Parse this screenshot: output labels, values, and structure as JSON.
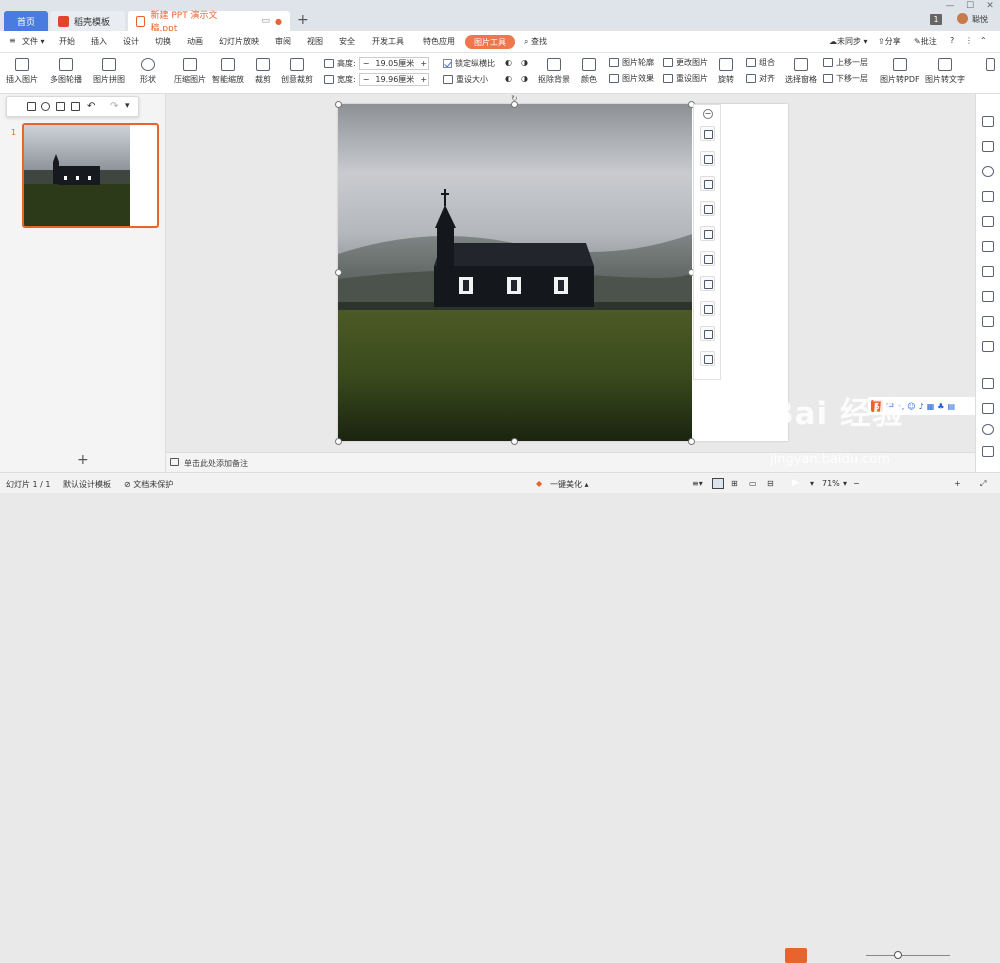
{
  "titlebar": {
    "tab_home": "首页",
    "tab_template": "稻壳模板",
    "tab_document": "新建 PPT 演示文稿.ppt",
    "page_badge": "1",
    "user_name": "聪悦"
  },
  "menubar": {
    "file": "文件",
    "items": [
      "开始",
      "插入",
      "设计",
      "切换",
      "动画",
      "幻灯片放映",
      "审阅",
      "视图",
      "安全",
      "开发工具",
      "特色应用"
    ],
    "picture_tool": "图片工具",
    "search": "查找",
    "sync": "未同步",
    "share": "分享",
    "annotate": "批注"
  },
  "ribbon": {
    "insert_picture": "插入图片",
    "multi_outline": "多图轮播",
    "picture_collage": "图片拼图",
    "shape": "形状",
    "compress": "压缩图片",
    "smart_zoom": "智能缩放",
    "crop": "裁剪",
    "creative_crop": "创意裁剪",
    "height_label": "高度:",
    "height_value": "19.05厘米",
    "width_label": "宽度:",
    "width_value": "19.96厘米",
    "lock_ratio": "锁定纵横比",
    "reset_size": "重设大小",
    "remove_bg": "抠除背景",
    "color": "颜色",
    "outline": "图片轮廓",
    "effect": "图片效果",
    "change_pic": "更改图片",
    "reset_pic": "重设图片",
    "rotate": "旋转",
    "group": "组合",
    "align": "对齐",
    "select_pane": "选择窗格",
    "bring_forward": "上移一层",
    "send_backward": "下移一层",
    "to_pdf": "图片转PDF",
    "to_text": "图片转文字"
  },
  "sidebar": {
    "slide_number": "1"
  },
  "notes": {
    "placeholder": "单击此处添加备注"
  },
  "status": {
    "slide_info": "幻灯片 1 / 1",
    "template": "默认设计模板",
    "protect": "文档未保护",
    "beautify": "一键美化",
    "zoom": "71%"
  },
  "ime": {
    "label": "中"
  },
  "watermark": {
    "brand": "Bai 经验",
    "url": "jingyan.baidu.com"
  },
  "colors": {
    "accent": "#e8642e",
    "tab_blue": "#4a7be0",
    "picture_tool": "#f0764d"
  }
}
